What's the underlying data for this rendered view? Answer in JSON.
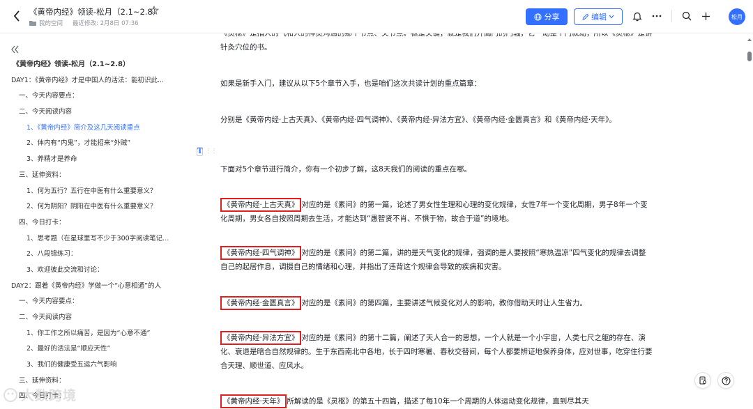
{
  "header": {
    "title": "《黄帝内经》领读-松月（2.1~2.8）",
    "space": "我的空间",
    "modified": "最近修改: 2月8日 07:36",
    "share_label": "分享",
    "edit_label": "编辑",
    "avatar_text": "松月"
  },
  "colors": {
    "accent": "#3370ff",
    "highlight_border": "#e02020"
  },
  "sidebar": {
    "items": [
      {
        "label": "《黄帝内经》领读-松月（2.1~2.8）",
        "level": 0
      },
      {
        "label": "DAY1：《黄帝内经》才是中国人的活法：能初识此...",
        "level": 1
      },
      {
        "label": "一、今天内容要点：",
        "level": 2
      },
      {
        "label": "二、今天阅读内容",
        "level": 2
      },
      {
        "label": "1、《黄帝内经》简介及这几天阅读重点",
        "level": 3,
        "active": true
      },
      {
        "label": "2、体内有“内鬼”，才能招来“外贼”",
        "level": 3
      },
      {
        "label": "3、养精才是养命",
        "level": 3
      },
      {
        "label": "三、延伸资料：",
        "level": 2
      },
      {
        "label": "1、何为五行？五行在中医有什么重要意义？",
        "level": 3
      },
      {
        "label": "2、何为阴阳？阴阳在中医有什么重要意义？",
        "level": 3
      },
      {
        "label": "四、今日打卡：",
        "level": 2
      },
      {
        "label": "1、思考题（在星球里写不少于300字阅读笔记...",
        "level": 3
      },
      {
        "label": "2、八段锦练习：",
        "level": 3
      },
      {
        "label": "3、欢迎彼此交流和讨论：",
        "level": 3
      },
      {
        "label": "DAY2：跟着《黄帝内经》学做一个“心意相通”的人",
        "level": 1
      },
      {
        "label": "一、今天内容要点：",
        "level": 2
      },
      {
        "label": "二、今天阅读内容",
        "level": 2
      },
      {
        "label": "1、你工作之所以痛苦，是因为“心意不通”",
        "level": 3
      },
      {
        "label": "2、最好的活法是“顺应天性”",
        "level": 3
      },
      {
        "label": "3、我们的健康受五运六气影响",
        "level": 3
      },
      {
        "label": "三、延伸资料：",
        "level": 2
      },
      {
        "label": "四、今日打卡：",
        "level": 2
      }
    ]
  },
  "content": {
    "p0": "《灵枢》是指人的气和人的神灵沟通的那个节点、关节点。枢是关键，就是我们开阖门的门轴，它一动整个门就动，所以《灵枢》是讲针灸穴位的书。",
    "p1": "如果是新手入门，建议从以下5个章节入手，也是咱们这次共读计划的重点篇章：",
    "p2": "分别是《黄帝内经·上古天真》、《黄帝内经·四气调神》、《黄帝内经·异法方宜》、《黄帝内经·金匮真言》和《黄帝内经·天年》。",
    "p3": "下面对5个章节进行简介，你有一个初步了解，这8天我们的阅读的重点在哪。",
    "p4_hl": "《黄帝内经·上古天真》",
    "p4": "对应的是《素问》的第一篇，论述了男女性生理和心理的变化规律，女性7年一个变化周期，男子8年一个变化周期，男女各自按照周期去生活，才能达到“愚智贤不肖、不惧于物，故合于道”的境地。",
    "p5_hl": "《黄帝内经·四气调神》",
    "p5": "对应的是《素问》的第二篇，讲的是天气变化的规律，强调的是人要按照“寒热温凉”四气变化的规律去调整自己的起居作息，调摄自己的情绪和心理，并指出了违背这个规律会导致的疾病和灾害。",
    "p6_hl": "《黄帝内经·金匮真言》",
    "p6": "对应的是《素问》的第四篇，主要讲述气候变化对人的影响，教你借助天时让人生省力。",
    "p7_hl": "《黄帝内经·异法方宜》",
    "p7": "对应的是《素问》的第十二篇，阐述了天人合一的思想，一个人就是一个小宇宙，人类七尺之躯的存在、演化、衰退是暗合自然规律的。生于东西南北中各地，长于四时寒暑、春秋交替间，每个人都要辨证地保养身体，应对世事，吃穿住行要合天理、顺世道、应风水。",
    "p8_hl": "《黄帝内经·天年》",
    "p8": "所解读的是《灵枢》的第五十四篇，描述了每10年一个周期的人体运动变化规律，直到尽其天"
  },
  "watermark": "大数跨境"
}
